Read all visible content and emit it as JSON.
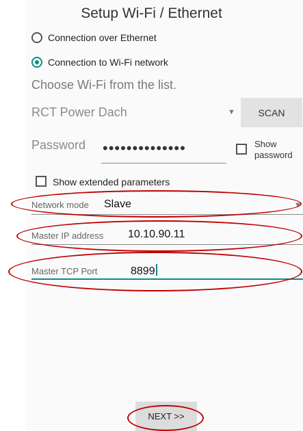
{
  "title": "Setup Wi-Fi / Ethernet",
  "connection_options": [
    {
      "label": "Connection over Ethernet",
      "selected": false
    },
    {
      "label": "Connection to Wi-Fi network",
      "selected": true
    }
  ],
  "wifi_hint": "Choose Wi-Fi from the list.",
  "wifi_network": "RCT Power Dach",
  "scan_label": "SCAN",
  "password_label": "Password",
  "password_masked": "••••••••••••••",
  "show_password_label": "Show password",
  "show_password_checked": false,
  "extended_label": "Show extended parameters",
  "extended_checked": false,
  "network_mode": {
    "label": "Network mode",
    "value": "Slave"
  },
  "master_ip": {
    "label": "Master IP address",
    "value": "10.10.90.11"
  },
  "master_tcp_port": {
    "label": "Master TCP Port",
    "value": "8899"
  },
  "next_label": "NEXT >>",
  "colors": {
    "accent": "#108a86",
    "annotation": "#c00000",
    "background": "#fafafa"
  }
}
